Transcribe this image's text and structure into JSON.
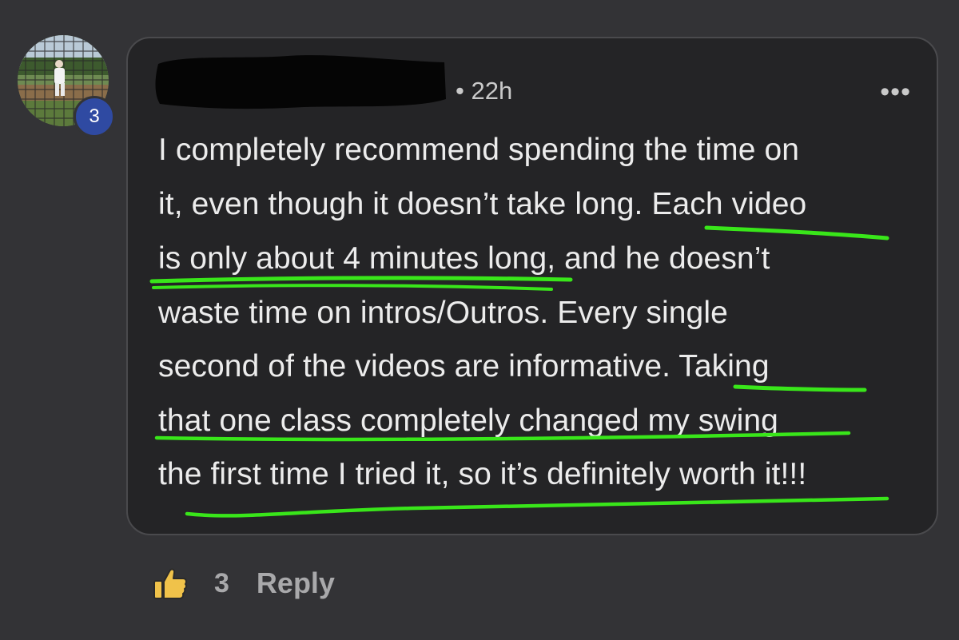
{
  "comment": {
    "avatar_badge": "3",
    "timestamp": "• 22h",
    "more_label": "•••",
    "lines": [
      "I completely recommend spending the time on",
      "it, even though it doesn’t take long. Each video",
      "is only about 4 minutes long, and he doesn’t",
      "waste time on intros/Outros. Every single",
      "second of the videos are informative. Taking",
      "that one class completely changed my swing",
      "the first time I tried it, so it’s definitely worth it!!!"
    ]
  },
  "actions": {
    "like_count": "3",
    "reply_label": "Reply"
  },
  "colors": {
    "background": "#333336",
    "bubble": "#242426",
    "highlight": "#39e61a",
    "badge": "#2f4aa2",
    "like_icon": "#f0c24a"
  },
  "icons": {
    "like": "thumbs-up-icon",
    "more": "ellipsis-icon"
  }
}
